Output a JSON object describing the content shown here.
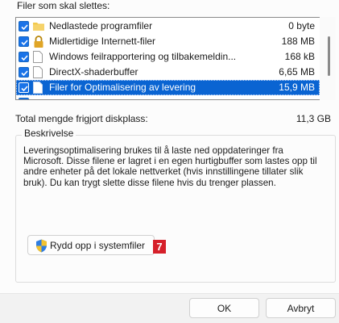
{
  "files_section": {
    "title": "Filer som skal slettes:",
    "items": [
      {
        "name": "Nedlastede programfiler",
        "size": "0 byte",
        "checked": true,
        "icon": "folder-icon"
      },
      {
        "name": "Midlertidige Internett-filer",
        "size": "188 MB",
        "checked": true,
        "icon": "lock-icon"
      },
      {
        "name": "Windows feilrapportering og tilbakemeldin...",
        "size": "168 kB",
        "checked": true,
        "icon": "file-icon"
      },
      {
        "name": "DirectX-shaderbuffer",
        "size": "6,65 MB",
        "checked": true,
        "icon": "file-icon"
      },
      {
        "name": "Filer for Optimalisering av levering",
        "size": "15,9 MB",
        "checked": true,
        "icon": "file-icon",
        "selected": true
      }
    ]
  },
  "total": {
    "label": "Total mengde frigjort diskplass:",
    "value": "11,3 GB"
  },
  "description": {
    "title": "Beskrivelse",
    "text": "Leveringsoptimalisering brukes til å laste ned oppdateringer fra Microsoft. Disse filene er lagret i en egen hurtigbuffer som lastes opp til andre enheter på det lokale nettverket (hvis innstillingene tillater slik bruk). Du kan trygt slette disse filene hvis du trenger plassen."
  },
  "cleanup_button": {
    "label": "Rydd opp i systemfiler",
    "badge": "7"
  },
  "footer": {
    "ok_label": "OK",
    "cancel_label": "Avbryt"
  },
  "colors": {
    "selection": "#0a64d2",
    "checkbox": "#1a73e8",
    "badge": "#d6202a"
  }
}
